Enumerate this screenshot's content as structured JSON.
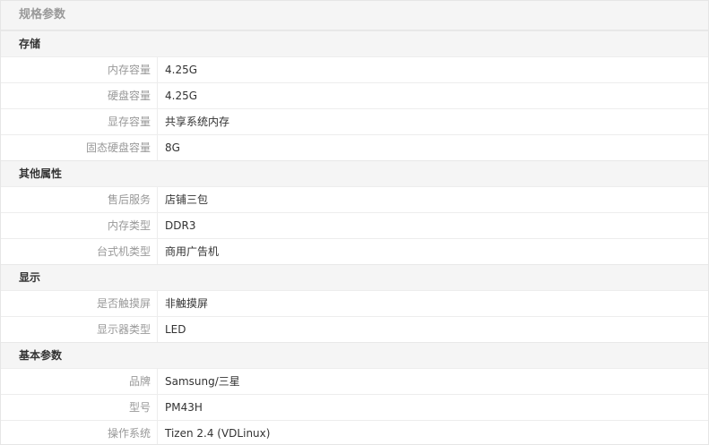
{
  "header": {
    "title": "规格参数"
  },
  "groups": [
    {
      "title": "存储",
      "rows": [
        {
          "label": "内存容量",
          "value": "4.25G"
        },
        {
          "label": "硬盘容量",
          "value": "4.25G"
        },
        {
          "label": "显存容量",
          "value": "共享系统内存"
        },
        {
          "label": "固态硬盘容量",
          "value": "8G"
        }
      ]
    },
    {
      "title": "其他属性",
      "rows": [
        {
          "label": "售后服务",
          "value": "店铺三包"
        },
        {
          "label": "内存类型",
          "value": "DDR3"
        },
        {
          "label": "台式机类型",
          "value": "商用广告机"
        }
      ]
    },
    {
      "title": "显示",
      "rows": [
        {
          "label": "是否触摸屏",
          "value": "非触摸屏"
        },
        {
          "label": "显示器类型",
          "value": "LED"
        }
      ]
    },
    {
      "title": "基本参数",
      "rows": [
        {
          "label": "品牌",
          "value": "Samsung/三星"
        },
        {
          "label": "型号",
          "value": "PM43H"
        },
        {
          "label": "操作系统",
          "value": "Tizen 2.4 (VDLinux)"
        }
      ]
    }
  ]
}
